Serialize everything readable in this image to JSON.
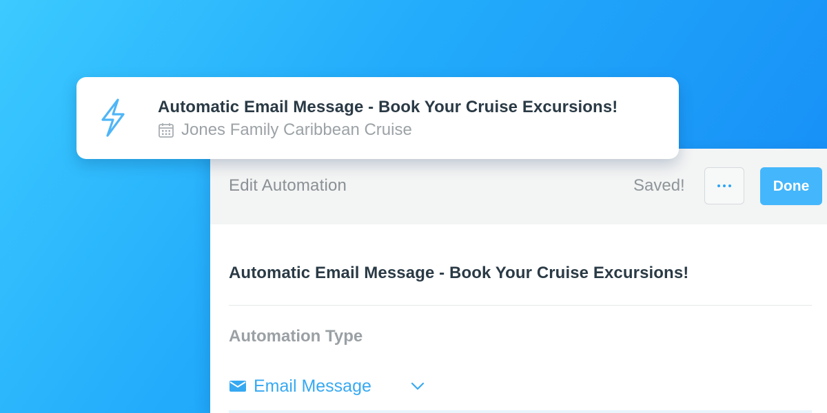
{
  "notification": {
    "icon": "lightning-bolt-icon",
    "title": "Automatic Email Message - Book Your Cruise Excursions!",
    "subtitle_icon": "calendar-icon",
    "subtitle": "Jones Family Caribbean Cruise"
  },
  "editor": {
    "header_title": "Edit Automation",
    "status": "Saved!",
    "more_icon": "ellipsis-icon",
    "done_label": "Done",
    "automation_name": "Automatic Email Message - Book Your Cruise Excursions!",
    "type_label": "Automation Type",
    "type_select": {
      "icon": "envelope-icon",
      "value": "Email Message",
      "dropdown_icon": "chevron-down-icon"
    }
  },
  "colors": {
    "accent": "#36a9f2",
    "done_button": "#44b6fb",
    "heading_text": "#2a3a45",
    "muted_text": "#9ca2a6",
    "background_gradient_start": "#3ccaff",
    "background_gradient_end": "#1487f5"
  }
}
